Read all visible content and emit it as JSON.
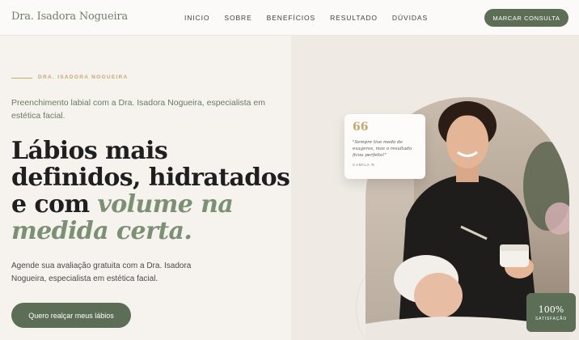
{
  "header": {
    "logo": "Dra. Isadora Nogueira",
    "nav": [
      "INICIO",
      "SOBRE",
      "BENEFÍCIOS",
      "RESULTADO",
      "DÚVIDAS"
    ],
    "cta": "MARCAR CONSULTA"
  },
  "hero": {
    "eyebrow": "DRA. ISADORA NOGUEIRA",
    "subtitle": "Preenchimento labial com a Dra. Isadora Nogueira, especialista em estética facial.",
    "headline_plain": "Lábios mais definidos, hidratados e com ",
    "headline_accent": "volume na medida certa.",
    "description": "Agende sua avaliação gratuita com a Dra. Isadora Nogueira, especialista em estética facial.",
    "cta": "Quero realçar meus lábios"
  },
  "testimonial": {
    "icon": "quote-icon",
    "quote_mark": "66",
    "text": "\"Sempre tive medo de exageros, mas o resultado ficou perfeito!\"",
    "author": "CAMILA R."
  },
  "stat": {
    "value": "100%",
    "label": "SATISFAÇÃO"
  },
  "colors": {
    "brand": "#5d6e56",
    "accent_green": "#7c9074",
    "gold": "#c6a76d",
    "background": "#f6f3ee"
  }
}
